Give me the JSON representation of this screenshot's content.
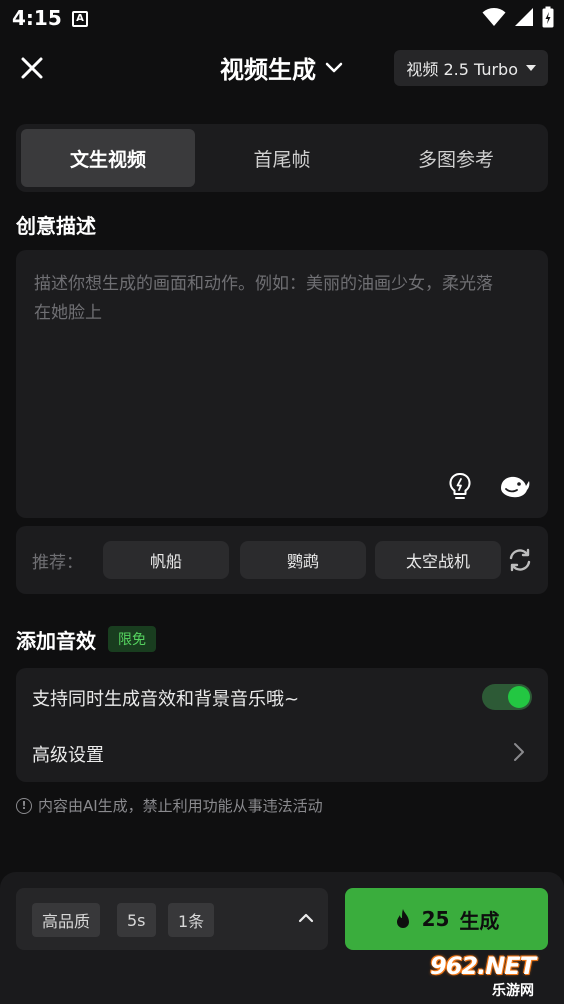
{
  "status_bar": {
    "time": "4:15",
    "notification_letter": "A"
  },
  "header": {
    "title": "视频生成",
    "model": "视频 2.5 Turbo"
  },
  "tabs": [
    {
      "label": "文生视频",
      "active": true
    },
    {
      "label": "首尾帧",
      "active": false
    },
    {
      "label": "多图参考",
      "active": false
    }
  ],
  "description": {
    "label": "创意描述",
    "placeholder": "描述你想生成的画面和动作。例如：美丽的油画少女，柔光落在她脸上",
    "value": ""
  },
  "recommendations": {
    "label": "推荐：",
    "items": [
      "帆船",
      "鹦鹉",
      "太空战机"
    ]
  },
  "audio": {
    "title": "添加音效",
    "badge": "限免",
    "toggle_label": "支持同时生成音效和背景音乐哦~",
    "toggle_on": true,
    "advanced_label": "高级设置"
  },
  "notice": "内容由AI生成，禁止利用功能从事违法活动",
  "bottom": {
    "options": [
      "高品质",
      "5s",
      "1条"
    ],
    "cost": "25",
    "generate_label": "生成"
  },
  "watermark": {
    "big": "962.NET",
    "small": "乐游网"
  },
  "colors": {
    "accent_green": "#3aad3d",
    "toggle_green": "#23c742",
    "badge_green": "#55d35f",
    "background": "#0f0f10",
    "card": "#1c1c1e"
  }
}
